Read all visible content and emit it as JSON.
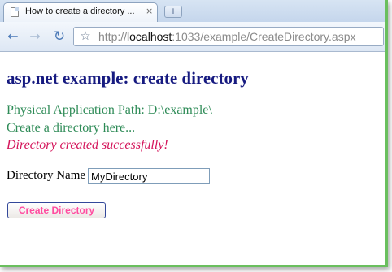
{
  "browser": {
    "tab_title": "How to create a directory ...",
    "tab_close": "×",
    "new_tab": "+",
    "back_icon": "←",
    "forward_icon": "→",
    "reload_icon": "↻",
    "star_icon": "☆",
    "url_scheme": "http://",
    "url_host": "localhost",
    "url_rest": ":1033/example/CreateDirectory.aspx"
  },
  "page": {
    "heading": "asp.net example: create directory",
    "physical_path": "Physical Application Path: D:\\example\\",
    "create_here": "Create a directory here...",
    "status_message": "Directory created successfully!",
    "directory_label": "Directory Name",
    "directory_value": "MyDirectory",
    "create_button": "Create Directory"
  },
  "colors": {
    "heading": "#161a80",
    "info_text": "#2e8b57",
    "status_text": "#d4145a",
    "button_text": "#ff4da0",
    "frame_border": "#6abf5e"
  }
}
